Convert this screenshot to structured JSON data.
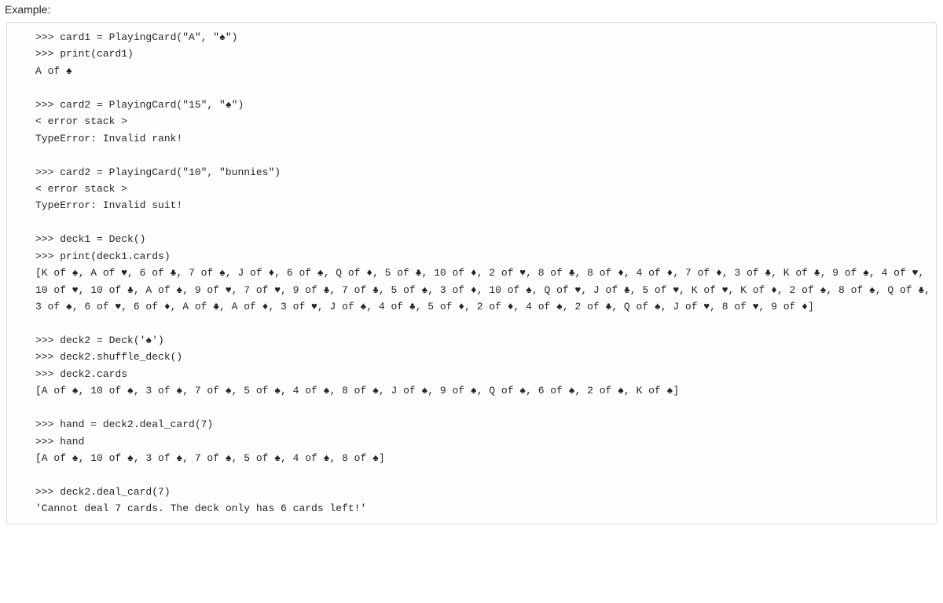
{
  "label": "Example:",
  "lines": [
    ">>> card1 = PlayingCard(\"A\", \"♠\")",
    ">>> print(card1)",
    "A of ♠",
    "",
    ">>> card2 = PlayingCard(\"15\", \"♠\")",
    "< error stack >",
    "TypeError: Invalid rank!",
    "",
    ">>> card2 = PlayingCard(\"10\", \"bunnies\")",
    "< error stack >",
    "TypeError: Invalid suit!",
    "",
    ">>> deck1 = Deck()",
    ">>> print(deck1.cards)",
    "[K of ♠, A of ♥, 6 of ♣, 7 of ♠, J of ♦, 6 of ♠, Q of ♦, 5 of ♣, 10 of ♦, 2 of ♥, 8 of ♣, 8 of ♦, 4 of ♦, 7 of ♦, 3 of ♣, K of ♣, 9 of ♠, 4 of ♥, 10 of ♥, 10 of ♣, A of ♠, 9 of ♥, 7 of ♥, 9 of ♣, 7 of ♣, 5 of ♠, 3 of ♦, 10 of ♠, Q of ♥, J of ♣, 5 of ♥, K of ♥, K of ♦, 2 of ♠, 8 of ♠, Q of ♣, 3 of ♠, 6 of ♥, 6 of ♦, A of ♣, A of ♦, 3 of ♥, J of ♠, 4 of ♣, 5 of ♦, 2 of ♦, 4 of ♠, 2 of ♣, Q of ♠, J of ♥, 8 of ♥, 9 of ♦]",
    "",
    ">>> deck2 = Deck('♠')",
    ">>> deck2.shuffle_deck()",
    ">>> deck2.cards",
    "[A of ♠, 10 of ♠, 3 of ♠, 7 of ♠, 5 of ♠, 4 of ♠, 8 of ♠, J of ♠, 9 of ♠, Q of ♠, 6 of ♠, 2 of ♠, K of ♠]",
    "",
    ">>> hand = deck2.deal_card(7)",
    ">>> hand",
    "[A of ♠, 10 of ♠, 3 of ♠, 7 of ♠, 5 of ♠, 4 of ♠, 8 of ♠]",
    "",
    ">>> deck2.deal_card(7)",
    "'Cannot deal 7 cards. The deck only has 6 cards left!'"
  ]
}
